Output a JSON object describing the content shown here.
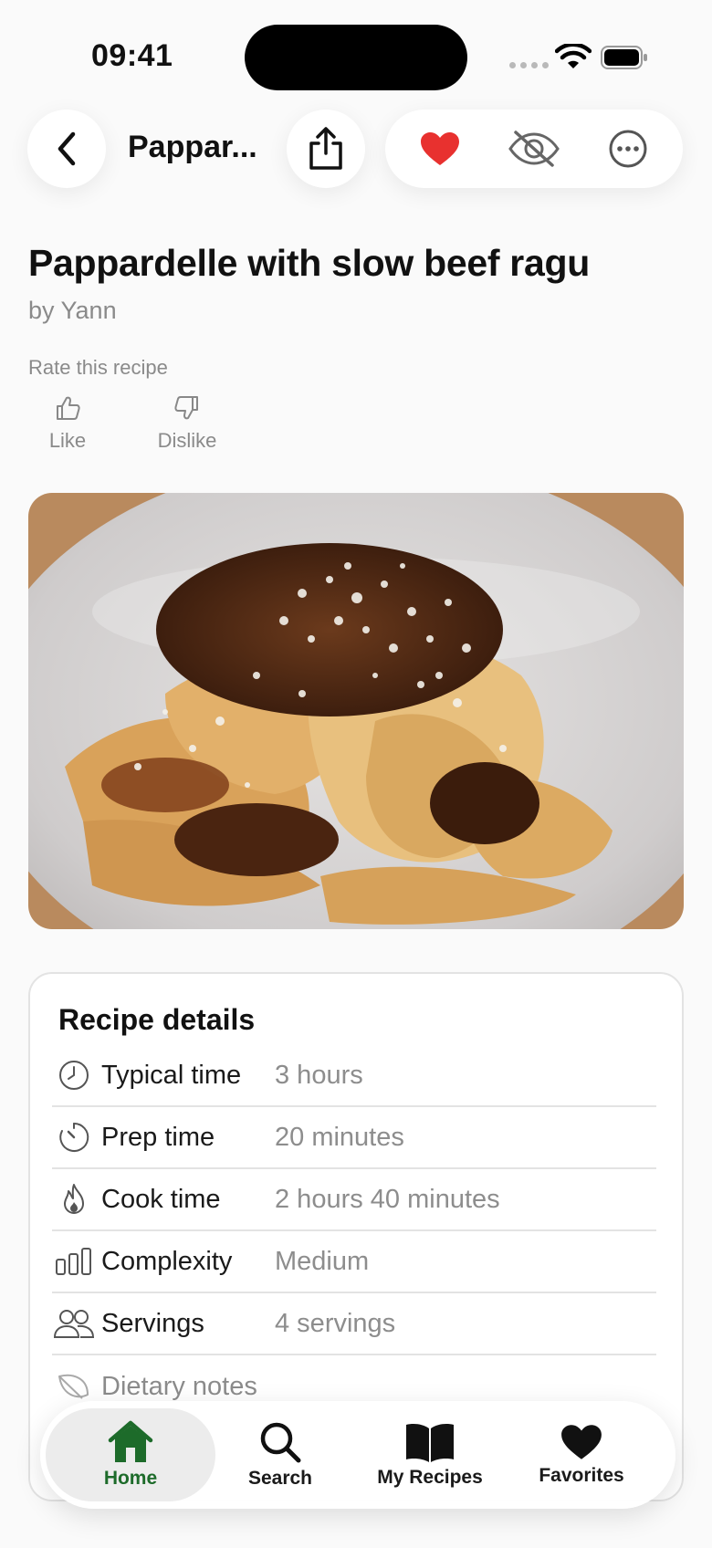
{
  "status_bar": {
    "time": "09:41"
  },
  "nav": {
    "title": "Pappar..."
  },
  "recipe": {
    "title": "Pappardelle with slow beef ragu",
    "author": "by Yann",
    "rate_label": "Rate this recipe",
    "like_label": "Like",
    "dislike_label": "Dislike"
  },
  "details": {
    "heading": "Recipe details",
    "rows": [
      {
        "icon": "clock-icon",
        "label": "Typical time",
        "value": "3 hours"
      },
      {
        "icon": "timer-icon",
        "label": "Prep time",
        "value": "20 minutes"
      },
      {
        "icon": "flame-icon",
        "label": "Cook time",
        "value": "2 hours 40 minutes"
      },
      {
        "icon": "bars-icon",
        "label": "Complexity",
        "value": "Medium"
      },
      {
        "icon": "people-icon",
        "label": "Servings",
        "value": "4 servings"
      },
      {
        "icon": "leaf-icon",
        "label": "Dietary notes",
        "value": ""
      }
    ]
  },
  "tabs": [
    {
      "label": "Home",
      "icon": "house-icon",
      "active": true
    },
    {
      "label": "Search",
      "icon": "magnifier-icon"
    },
    {
      "label": "My Recipes",
      "icon": "book-icon"
    },
    {
      "label": "Favorites",
      "icon": "heart-icon"
    }
  ],
  "colors": {
    "accent": "#1d6b2a",
    "favorite": "#e8312f",
    "muted": "#8a8a8a"
  }
}
